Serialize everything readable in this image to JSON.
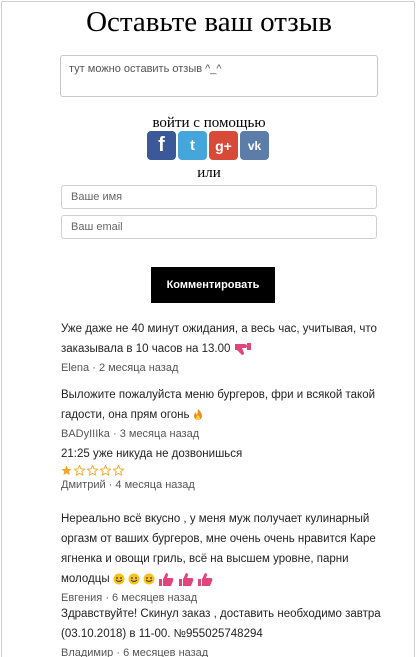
{
  "title": "Оставьте ваш отзыв",
  "comment_box": {
    "placeholder": "тут можно оставить отзыв ^_^"
  },
  "social": {
    "label": "войти с помощью",
    "icons": [
      "facebook-icon",
      "twitter-icon",
      "google-plus-icon",
      "vk-icon"
    ],
    "glyphs": {
      "facebook": "f",
      "twitter": "t",
      "googleplus": "g+",
      "vk": "vk"
    }
  },
  "or_label": "или",
  "form": {
    "name_placeholder": "Ваше имя",
    "email_placeholder": "Ваш email",
    "submit_label": "Комментировать"
  },
  "comments": [
    {
      "text": "Уже даже не 40 минут ожидания, а весь час, учитывая, что заказывала в 10 часов на 13.00",
      "author": "Elena",
      "time": "2 месяца назад"
    },
    {
      "text": "Выложите пожалуйста меню бургеров, фри и всякой такой гадости, она прям огонь",
      "author": "BADyIIIka",
      "time": "3 месяца назад"
    },
    {
      "text": "21:25 уже никуда не дозвонишься",
      "rating": 1,
      "max_rating": 5,
      "author": "Дмитрий",
      "time": "4 месяца назад"
    },
    {
      "text": "Нереально всё вкусно , у меня муж получает кулинарный оргазм от ваших бургеров, мне очень очень нравится Каре ягненка и овощи гриль, всё на высшем уровне, парни молодцы",
      "author": "Евгения",
      "time": "6 месяцев назад"
    },
    {
      "text": "Здравствуйте! Скинул заказ , доставить необходимо завтра (03.10.2018) в 11-00. №955025748294",
      "author": "Владимир",
      "time": "6 месяцев назад"
    }
  ],
  "meta_separator": "·",
  "colors": {
    "facebook": "#3b5998",
    "twitter": "#45a6db",
    "googleplus": "#d84a38",
    "vk": "#5b7da8",
    "star": "#f5a623",
    "thumb": "#e0457b"
  }
}
